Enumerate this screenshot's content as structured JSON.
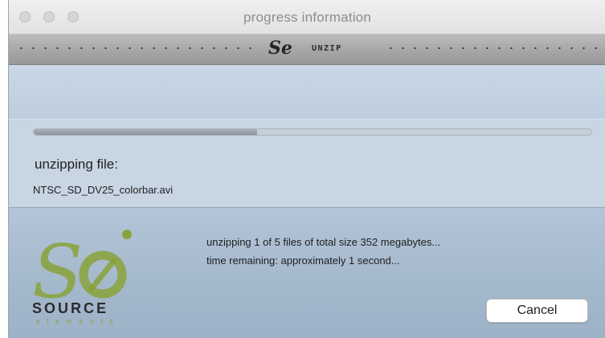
{
  "window": {
    "title": "progress information"
  },
  "banner": {
    "logo_text": "Se",
    "label": "UNZIP"
  },
  "progress": {
    "fraction": 0.4
  },
  "current": {
    "label": "unzipping file:",
    "filename": "NTSC_SD_DV25_colorbar.avi"
  },
  "status": {
    "line1": "unzipping 1 of 5 files of total size 352 megabytes...",
    "line2": "time remaining: approximately 1 second..."
  },
  "brand": {
    "name": "SOURCE",
    "tagline": "elements",
    "logo_color": "#8aa23a"
  },
  "buttons": {
    "cancel": "Cancel"
  },
  "icons": [
    "close-icon",
    "minimize-icon",
    "zoom-icon",
    "source-elements-logo-icon"
  ]
}
